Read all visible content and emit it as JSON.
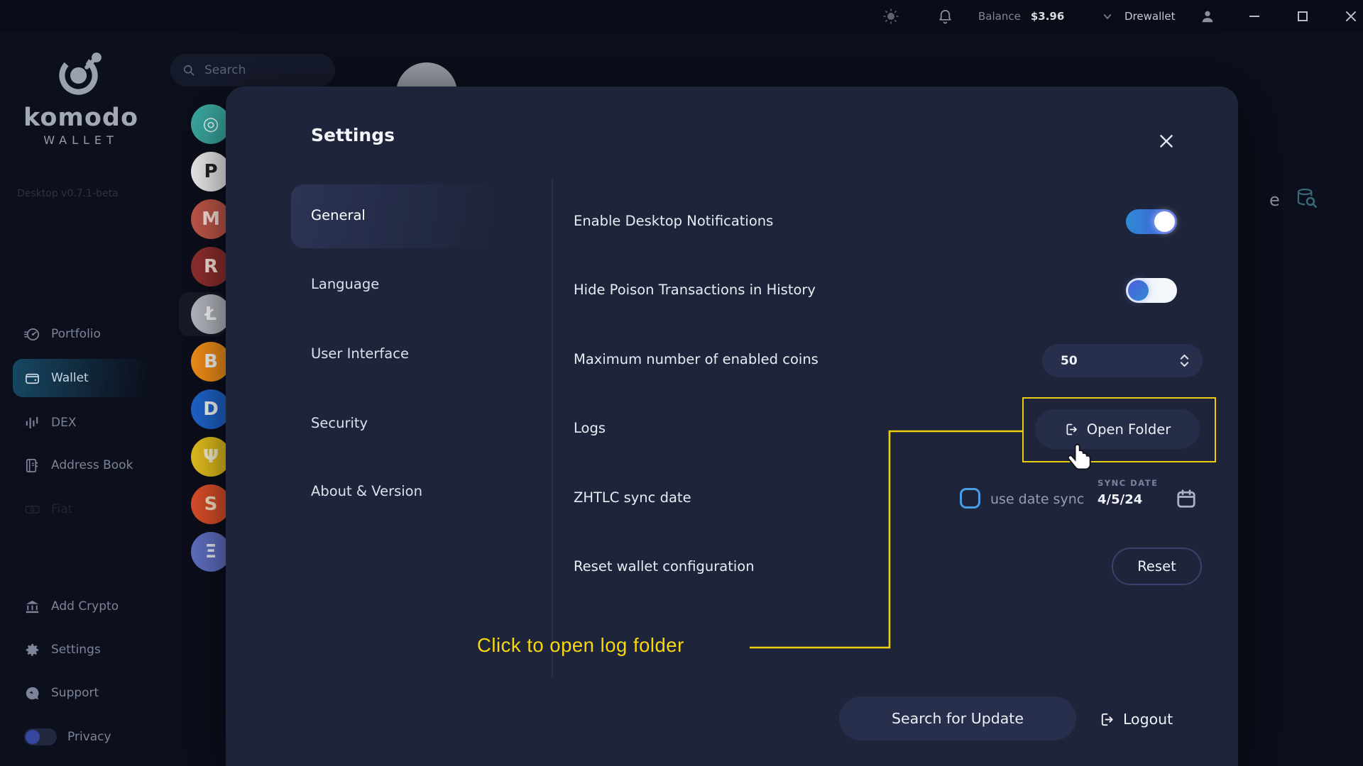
{
  "topbar": {
    "balance_label": "Balance",
    "balance_value": "$3.96",
    "account_name": "Drewallet"
  },
  "sidebar": {
    "brand_name": "komodo",
    "brand_sub": "WALLET",
    "version": "Desktop v0.7.1-beta",
    "search_placeholder": "Search",
    "nav": [
      {
        "label": "Portfolio"
      },
      {
        "label": "Wallet"
      },
      {
        "label": "DEX"
      },
      {
        "label": "Address Book"
      },
      {
        "label": "Fiat"
      }
    ],
    "bottom": [
      {
        "label": "Add Crypto"
      },
      {
        "label": "Settings"
      },
      {
        "label": "Support"
      },
      {
        "label": "Privacy"
      }
    ]
  },
  "coins": [
    {
      "name": "komodo",
      "glyph": "◎",
      "color": "#3aa9a0",
      "text": "#eafffb"
    },
    {
      "name": "panda",
      "glyph": "P",
      "color": "#f0f0f0",
      "text": "#222222"
    },
    {
      "name": "meme-red",
      "glyph": "M",
      "color": "#c4584a",
      "text": "#ffe9e2"
    },
    {
      "name": "meme-dark",
      "glyph": "R",
      "color": "#932f2f",
      "text": "#ffe9e2"
    },
    {
      "name": "litecoin",
      "glyph": "Ł",
      "color": "#b8bcc4",
      "text": "#ffffff"
    },
    {
      "name": "bitcoin",
      "glyph": "B",
      "color": "#f7931a",
      "text": "#ffffff"
    },
    {
      "name": "digibyte",
      "glyph": "D",
      "color": "#1f66d0",
      "text": "#ffffff"
    },
    {
      "name": "psi-coin",
      "glyph": "Ψ",
      "color": "#e8c31e",
      "text": "#fff8d8"
    },
    {
      "name": "shiba",
      "glyph": "S",
      "color": "#e0512a",
      "text": "#ffe9c9"
    },
    {
      "name": "ethereum",
      "glyph": "Ξ",
      "color": "#6373c8",
      "text": "#eef1ff"
    }
  ],
  "background_remnant": {
    "partial_text": "e"
  },
  "modal": {
    "title": "Settings",
    "tabs": [
      "General",
      "Language",
      "User Interface",
      "Security",
      "About & Version"
    ],
    "active_tab": "General",
    "rows": [
      {
        "label": "Enable Desktop Notifications",
        "control": "toggle",
        "state": "on"
      },
      {
        "label": "Hide Poison Transactions in History",
        "control": "toggle",
        "state": "on"
      },
      {
        "label": "Maximum number of enabled coins",
        "control": "stepper",
        "value": "50"
      },
      {
        "label": "Logs",
        "control": "button",
        "button_label": "Open Folder"
      },
      {
        "label": "ZHTLC sync date",
        "control": "date-sync",
        "checkbox_label": "use date sync",
        "checkbox_checked": false,
        "sync_date_label": "SYNC DATE",
        "sync_date_value": "4/5/24"
      },
      {
        "label": "Reset wallet configuration",
        "control": "button",
        "button_label": "Reset"
      }
    ],
    "footer": {
      "update_label": "Search for Update",
      "logout_label": "Logout"
    }
  },
  "annotation": {
    "text": "Click to open log folder",
    "color": "#f7d70f"
  },
  "colors": {
    "accent_yellow": "#e9cb12",
    "toggle_blue_start": "#2f8ad2",
    "toggle_blue_end": "#4657de",
    "modal_background": "#1e2439",
    "page_background": "#0c0f1c",
    "wallet_highlight_teal": "#2280a8"
  }
}
